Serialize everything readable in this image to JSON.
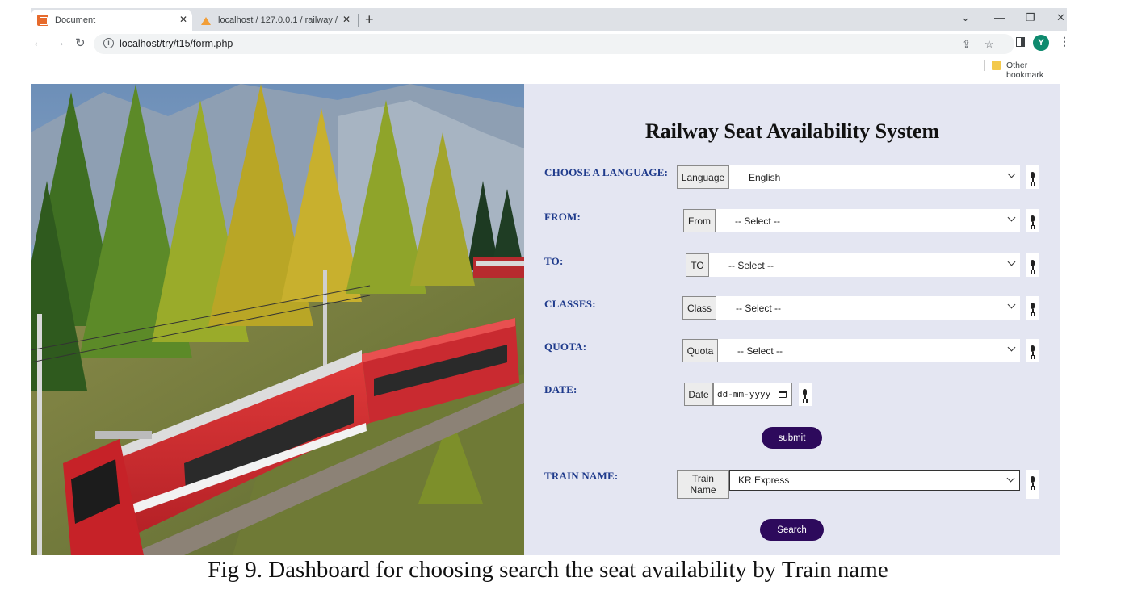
{
  "browser": {
    "tabs": [
      {
        "title": "Document",
        "active": true,
        "icon": "document-favicon-icon"
      },
      {
        "title": "localhost / 127.0.0.1 / railway / t...",
        "active": false,
        "icon": "phpmyadmin-favicon-icon"
      }
    ],
    "url": "localhost/try/t15/form.php",
    "profile_initial": "Y",
    "bookmarks_other": "Other bookmark"
  },
  "form": {
    "title": "Railway Seat Availability System",
    "language": {
      "label": "CHOOSE A LANGUAGE:",
      "addon": "Language",
      "value": "English"
    },
    "from": {
      "label": "FROM:",
      "addon": "From",
      "value": "-- Select --"
    },
    "to": {
      "label": "TO:",
      "addon": "TO",
      "value": "-- Select --"
    },
    "classes": {
      "label": "CLASSES:",
      "addon": "Class",
      "value": "-- Select --"
    },
    "quota": {
      "label": "QUOTA:",
      "addon": "Quota",
      "value": "-- Select --"
    },
    "date": {
      "label": "DATE:",
      "addon": "Date",
      "placeholder": "dd-mm-yyyy"
    },
    "submit_label": "submit",
    "train": {
      "label": "TRAIN NAME:",
      "addon_line1": "Train",
      "addon_line2": "Name",
      "value": "KR Express"
    },
    "search_label": "Search"
  },
  "caption": "Fig 9. Dashboard for choosing search the seat availability by Train name",
  "colors": {
    "label_blue": "#1f3b8c",
    "button_purple": "#2d0a5c",
    "panel_bg": "#e4e6f2"
  }
}
